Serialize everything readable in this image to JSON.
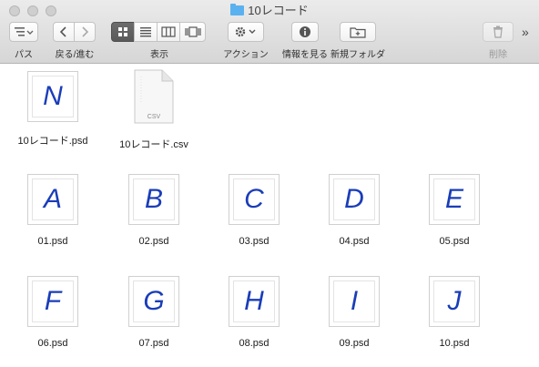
{
  "window": {
    "title": "10レコード"
  },
  "toolbar": {
    "path_label": "パス",
    "nav_label": "戻る/進む",
    "view_label": "表示",
    "action_label": "アクション",
    "info_label": "情報を見る",
    "newfolder_label": "新規フォルダ",
    "delete_label": "削除",
    "more_glyph": "»"
  },
  "files": [
    {
      "name": "10レコード.psd",
      "letter": "N",
      "icon": "psd-thumbnail-icon"
    },
    {
      "name": "10レコード.csv",
      "doc_tag": "CSV",
      "icon": "csv-document-icon"
    },
    {
      "name": "01.psd",
      "letter": "A",
      "icon": "psd-thumbnail-icon"
    },
    {
      "name": "02.psd",
      "letter": "B",
      "icon": "psd-thumbnail-icon"
    },
    {
      "name": "03.psd",
      "letter": "C",
      "icon": "psd-thumbnail-icon"
    },
    {
      "name": "04.psd",
      "letter": "D",
      "icon": "psd-thumbnail-icon"
    },
    {
      "name": "05.psd",
      "letter": "E",
      "icon": "psd-thumbnail-icon"
    },
    {
      "name": "06.psd",
      "letter": "F",
      "icon": "psd-thumbnail-icon"
    },
    {
      "name": "07.psd",
      "letter": "G",
      "icon": "psd-thumbnail-icon"
    },
    {
      "name": "08.psd",
      "letter": "H",
      "icon": "psd-thumbnail-icon"
    },
    {
      "name": "09.psd",
      "letter": "I",
      "icon": "psd-thumbnail-icon"
    },
    {
      "name": "10.psd",
      "letter": "J",
      "icon": "psd-thumbnail-icon"
    }
  ],
  "colors": {
    "thumbnail_letter": "#1a3db8",
    "folder_icon": "#5ab1ef"
  }
}
